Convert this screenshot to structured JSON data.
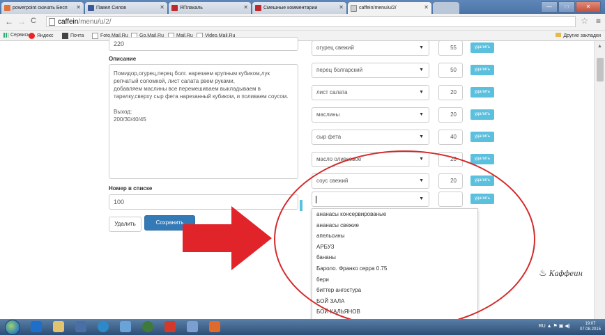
{
  "browser": {
    "tabs": [
      {
        "label": "powerpoint скачать Бесп",
        "color": "#e0733c"
      },
      {
        "label": "Павел Силов",
        "color": "#3b5998"
      },
      {
        "label": "ЯПлакаль",
        "color": "#c0282d"
      },
      {
        "label": "Смешные комментарии",
        "color": "#c0282d"
      },
      {
        "label": "caffein/menu/u/2/",
        "color": "#888888"
      }
    ],
    "url_host": "caffein",
    "url_path": "/menu/u/2/",
    "bookmarks": [
      "Сервисы",
      "Яндекс",
      "Почта",
      "Foto.Mail.Ru",
      "Go.Mail.Ru",
      "Mail.Ru",
      "Video.Mail.Ru"
    ],
    "other_bookmarks": "Другие закладки"
  },
  "form": {
    "top_value": "220",
    "description_label": "Описание",
    "description_text": "Помидор,огурец,перец болг. нарезаем крупным кубиком,лук репчатый соломкой, лист салата рвем руками,\nдобавляем маслины все перемешиваем выкладываем в тарелку,сверху сыр фета нарезанный кубиком, и поливаем соусом.\n\nВыход:\n200/30/40/45",
    "order_label": "Номер в списке",
    "order_value": "100",
    "delete_label": "Удалить",
    "save_label": "Сохранить"
  },
  "ingredients": [
    {
      "name": "огурец свежий",
      "qty": "55"
    },
    {
      "name": "перец болгарский",
      "qty": "50"
    },
    {
      "name": "лист салата",
      "qty": "20"
    },
    {
      "name": "маслины",
      "qty": "20"
    },
    {
      "name": "сыр фета",
      "qty": "40"
    },
    {
      "name": "масло оливковое",
      "qty": "20"
    },
    {
      "name": "соус свежий",
      "qty": "20"
    },
    {
      "name": "",
      "qty": ""
    }
  ],
  "remove_label": "удалить",
  "dropdown_options": [
    "ананасы консервированые",
    "ананасы свежие",
    "апельсины",
    "АРБУЗ",
    "бананы",
    "Бароло. Франко серра 0.75",
    "бери",
    "биттер ангостура",
    "БОЙ ЗАЛА",
    "БОЙ КАЛЬЯНОВ"
  ],
  "logo_text": "Каффеин",
  "taskbar": {
    "lang": "RU",
    "time": "19:07",
    "date": "07.08.2015"
  },
  "colors": {
    "annotation": "#d42a2a",
    "primary": "#337ab7",
    "info": "#5bc0de"
  }
}
